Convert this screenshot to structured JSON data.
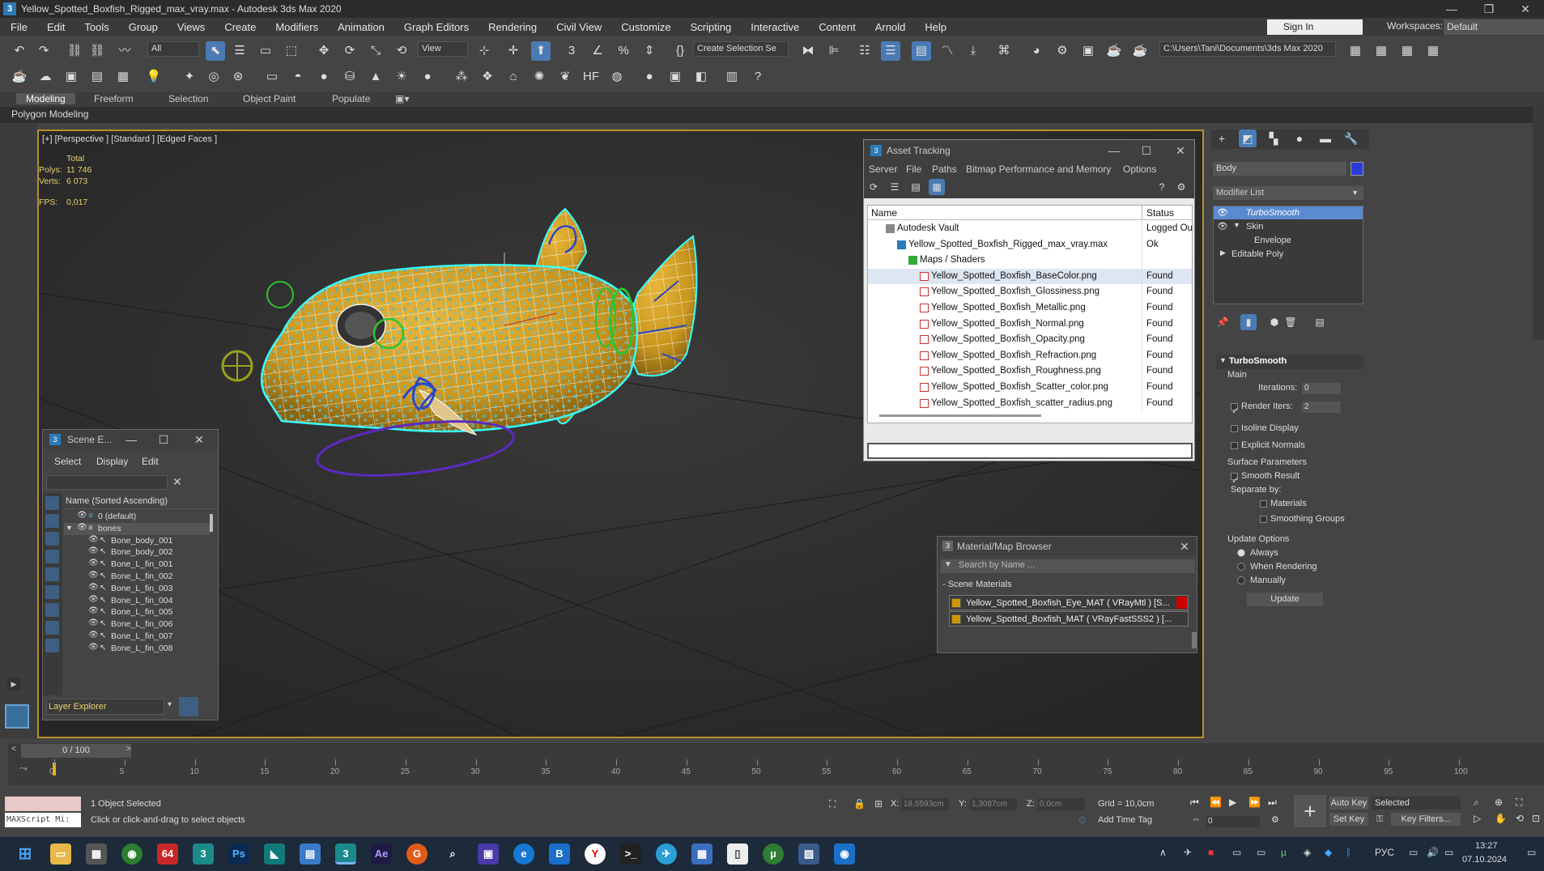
{
  "window": {
    "title": "Yellow_Spotted_Boxfish_Rigged_max_vray.max - Autodesk 3ds Max 2020",
    "icon": "3"
  },
  "menu": [
    "File",
    "Edit",
    "Tools",
    "Group",
    "Views",
    "Create",
    "Modifiers",
    "Animation",
    "Graph Editors",
    "Rendering",
    "Civil View",
    "Customize",
    "Scripting",
    "Interactive",
    "Content",
    "Arnold",
    "Help"
  ],
  "account": {
    "signin": "Sign In",
    "workspaces_label": "Workspaces:",
    "workspace": "Default"
  },
  "toolbar": {
    "filter": "All",
    "view": "View",
    "create_selection": "Create Selection Se",
    "path": "C:\\Users\\Tani\\Documents\\3ds Max 2020"
  },
  "ribbon": {
    "tabs": [
      "Modeling",
      "Freeform",
      "Selection",
      "Object Paint",
      "Populate"
    ],
    "active": "Modeling",
    "sub": "Polygon Modeling"
  },
  "viewport": {
    "label": "[+] [Perspective ] [Standard ] [Edged Faces ]",
    "stats": {
      "total_label": "Total",
      "polys_label": "Polys:",
      "polys": "11 746",
      "verts_label": "Verts:",
      "verts": "6 073",
      "fps_label": "FPS:",
      "fps": "0,017"
    }
  },
  "asset_tracking": {
    "title": "Asset Tracking",
    "menu": [
      "Server",
      "File",
      "Paths",
      "Bitmap Performance and Memory",
      "Options"
    ],
    "col_name": "Name",
    "col_status": "Status",
    "rows": [
      {
        "name": "Autodesk Vault",
        "status": "Logged Ou",
        "indent": 1
      },
      {
        "name": "Yellow_Spotted_Boxfish_Rigged_max_vray.max",
        "status": "Ok",
        "indent": 2
      },
      {
        "name": "Maps / Shaders",
        "status": "",
        "indent": 3
      },
      {
        "name": "Yellow_Spotted_Boxfish_BaseColor.png",
        "status": "Found",
        "indent": 4
      },
      {
        "name": "Yellow_Spotted_Boxfish_Glossiness.png",
        "status": "Found",
        "indent": 4
      },
      {
        "name": "Yellow_Spotted_Boxfish_Metallic.png",
        "status": "Found",
        "indent": 4
      },
      {
        "name": "Yellow_Spotted_Boxfish_Normal.png",
        "status": "Found",
        "indent": 4
      },
      {
        "name": "Yellow_Spotted_Boxfish_Opacity.png",
        "status": "Found",
        "indent": 4
      },
      {
        "name": "Yellow_Spotted_Boxfish_Refraction.png",
        "status": "Found",
        "indent": 4
      },
      {
        "name": "Yellow_Spotted_Boxfish_Roughness.png",
        "status": "Found",
        "indent": 4
      },
      {
        "name": "Yellow_Spotted_Boxfish_Scatter_color.png",
        "status": "Found",
        "indent": 4
      },
      {
        "name": "Yellow_Spotted_Boxfish_scatter_radius.png",
        "status": "Found",
        "indent": 4
      }
    ]
  },
  "material_browser": {
    "title": "Material/Map Browser",
    "search_placeholder": "Search by Name ...",
    "section": "- Scene Materials",
    "items": [
      "Yellow_Spotted_Boxfish_Eye_MAT ( VRayMtl ) [S...",
      "Yellow_Spotted_Boxfish_MAT ( VRayFastSSS2 ) [..."
    ]
  },
  "scene_explorer": {
    "title": "Scene E...",
    "menu": [
      "Select",
      "Display",
      "Edit"
    ],
    "header": "Name (Sorted Ascending)",
    "items": [
      "0 (default)",
      "bones",
      "Bone_body_001",
      "Bone_body_002",
      "Bone_L_fin_001",
      "Bone_L_fin_002",
      "Bone_L_fin_003",
      "Bone_L_fin_004",
      "Bone_L_fin_005",
      "Bone_L_fin_006",
      "Bone_L_fin_007",
      "Bone_L_fin_008"
    ],
    "footer": "Layer Explorer"
  },
  "command_panel": {
    "object_name": "Body",
    "modifier_list": "Modifier List",
    "stack": [
      "TurboSmooth",
      "Skin",
      "Envelope",
      "Editable Poly"
    ],
    "rollout": "TurboSmooth",
    "main": "Main",
    "iterations_label": "Iterations:",
    "iterations": "0",
    "render_iters_label": "Render Iters:",
    "render_iters": "2",
    "isoline": "Isoline Display",
    "explicit_normals": "Explicit Normals",
    "surface_params": "Surface Parameters",
    "smooth_result": "Smooth Result",
    "separate_by": "Separate by:",
    "materials": "Materials",
    "smoothing_groups": "Smoothing Groups",
    "update_options": "Update Options",
    "always": "Always",
    "when_rendering": "When Rendering",
    "manually": "Manually",
    "update_btn": "Update"
  },
  "timeline": {
    "frame": "0 / 100",
    "ticks": [
      "0",
      "5",
      "10",
      "15",
      "20",
      "25",
      "30",
      "35",
      "40",
      "45",
      "50",
      "55",
      "60",
      "65",
      "70",
      "75",
      "80",
      "85",
      "90",
      "95",
      "100"
    ]
  },
  "status": {
    "selected": "1 Object Selected",
    "prompt": "Click or click-and-drag to select objects",
    "maxscript": "MAXScript Mi:",
    "x_label": "X:",
    "x": "18,5593cm",
    "y_label": "Y:",
    "y": "1,3087cm",
    "z_label": "Z:",
    "z": "0,0cm",
    "grid": "Grid = 10,0cm",
    "add_time_tag": "Add Time Tag",
    "auto_key": "Auto Key",
    "set_key": "Set Key",
    "selected_dd": "Selected",
    "key_filters": "Key Filters...",
    "frame_field": "0"
  },
  "taskbar": {
    "lang": "РУС",
    "time": "13:27",
    "date": "07.10.2024"
  }
}
